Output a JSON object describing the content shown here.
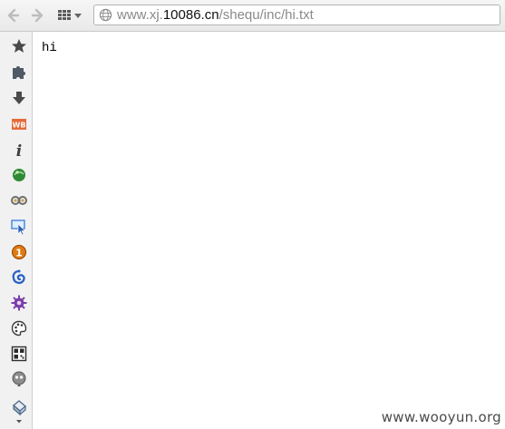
{
  "toolbar": {
    "back_icon": "back-arrow-icon",
    "forward_icon": "forward-arrow-icon",
    "apps_icon": "apps-grid-icon"
  },
  "address_bar": {
    "url_prefix": "www.xj.",
    "url_domain": "10086.cn",
    "url_path": "/shequ/inc/hi.txt",
    "site_icon": "globe-icon"
  },
  "sidebar": {
    "items": [
      {
        "icon": "star-icon"
      },
      {
        "icon": "puzzle-icon"
      },
      {
        "icon": "download-arrow-icon"
      },
      {
        "icon": "wb-icon",
        "text": "WB"
      },
      {
        "icon": "info-icon",
        "text": "i"
      },
      {
        "icon": "green-ball-icon"
      },
      {
        "icon": "binoculars-icon"
      },
      {
        "icon": "cursor-select-icon"
      },
      {
        "icon": "warning-badge-icon",
        "text": "1"
      },
      {
        "icon": "blue-swirl-icon"
      },
      {
        "icon": "purple-gear-icon"
      },
      {
        "icon": "palette-icon"
      },
      {
        "icon": "qr-icon"
      },
      {
        "icon": "robot-icon"
      },
      {
        "icon": "eraser-icon"
      }
    ]
  },
  "content": {
    "text": "hi"
  },
  "watermark": {
    "text": "www.wooyun.org"
  },
  "colors": {
    "wb_orange": "#e46a3a",
    "info_gray": "#3c3c3c",
    "warning_orange": "#e07a10",
    "swirl_blue": "#2b62c4",
    "purple": "#7a3ea8"
  }
}
